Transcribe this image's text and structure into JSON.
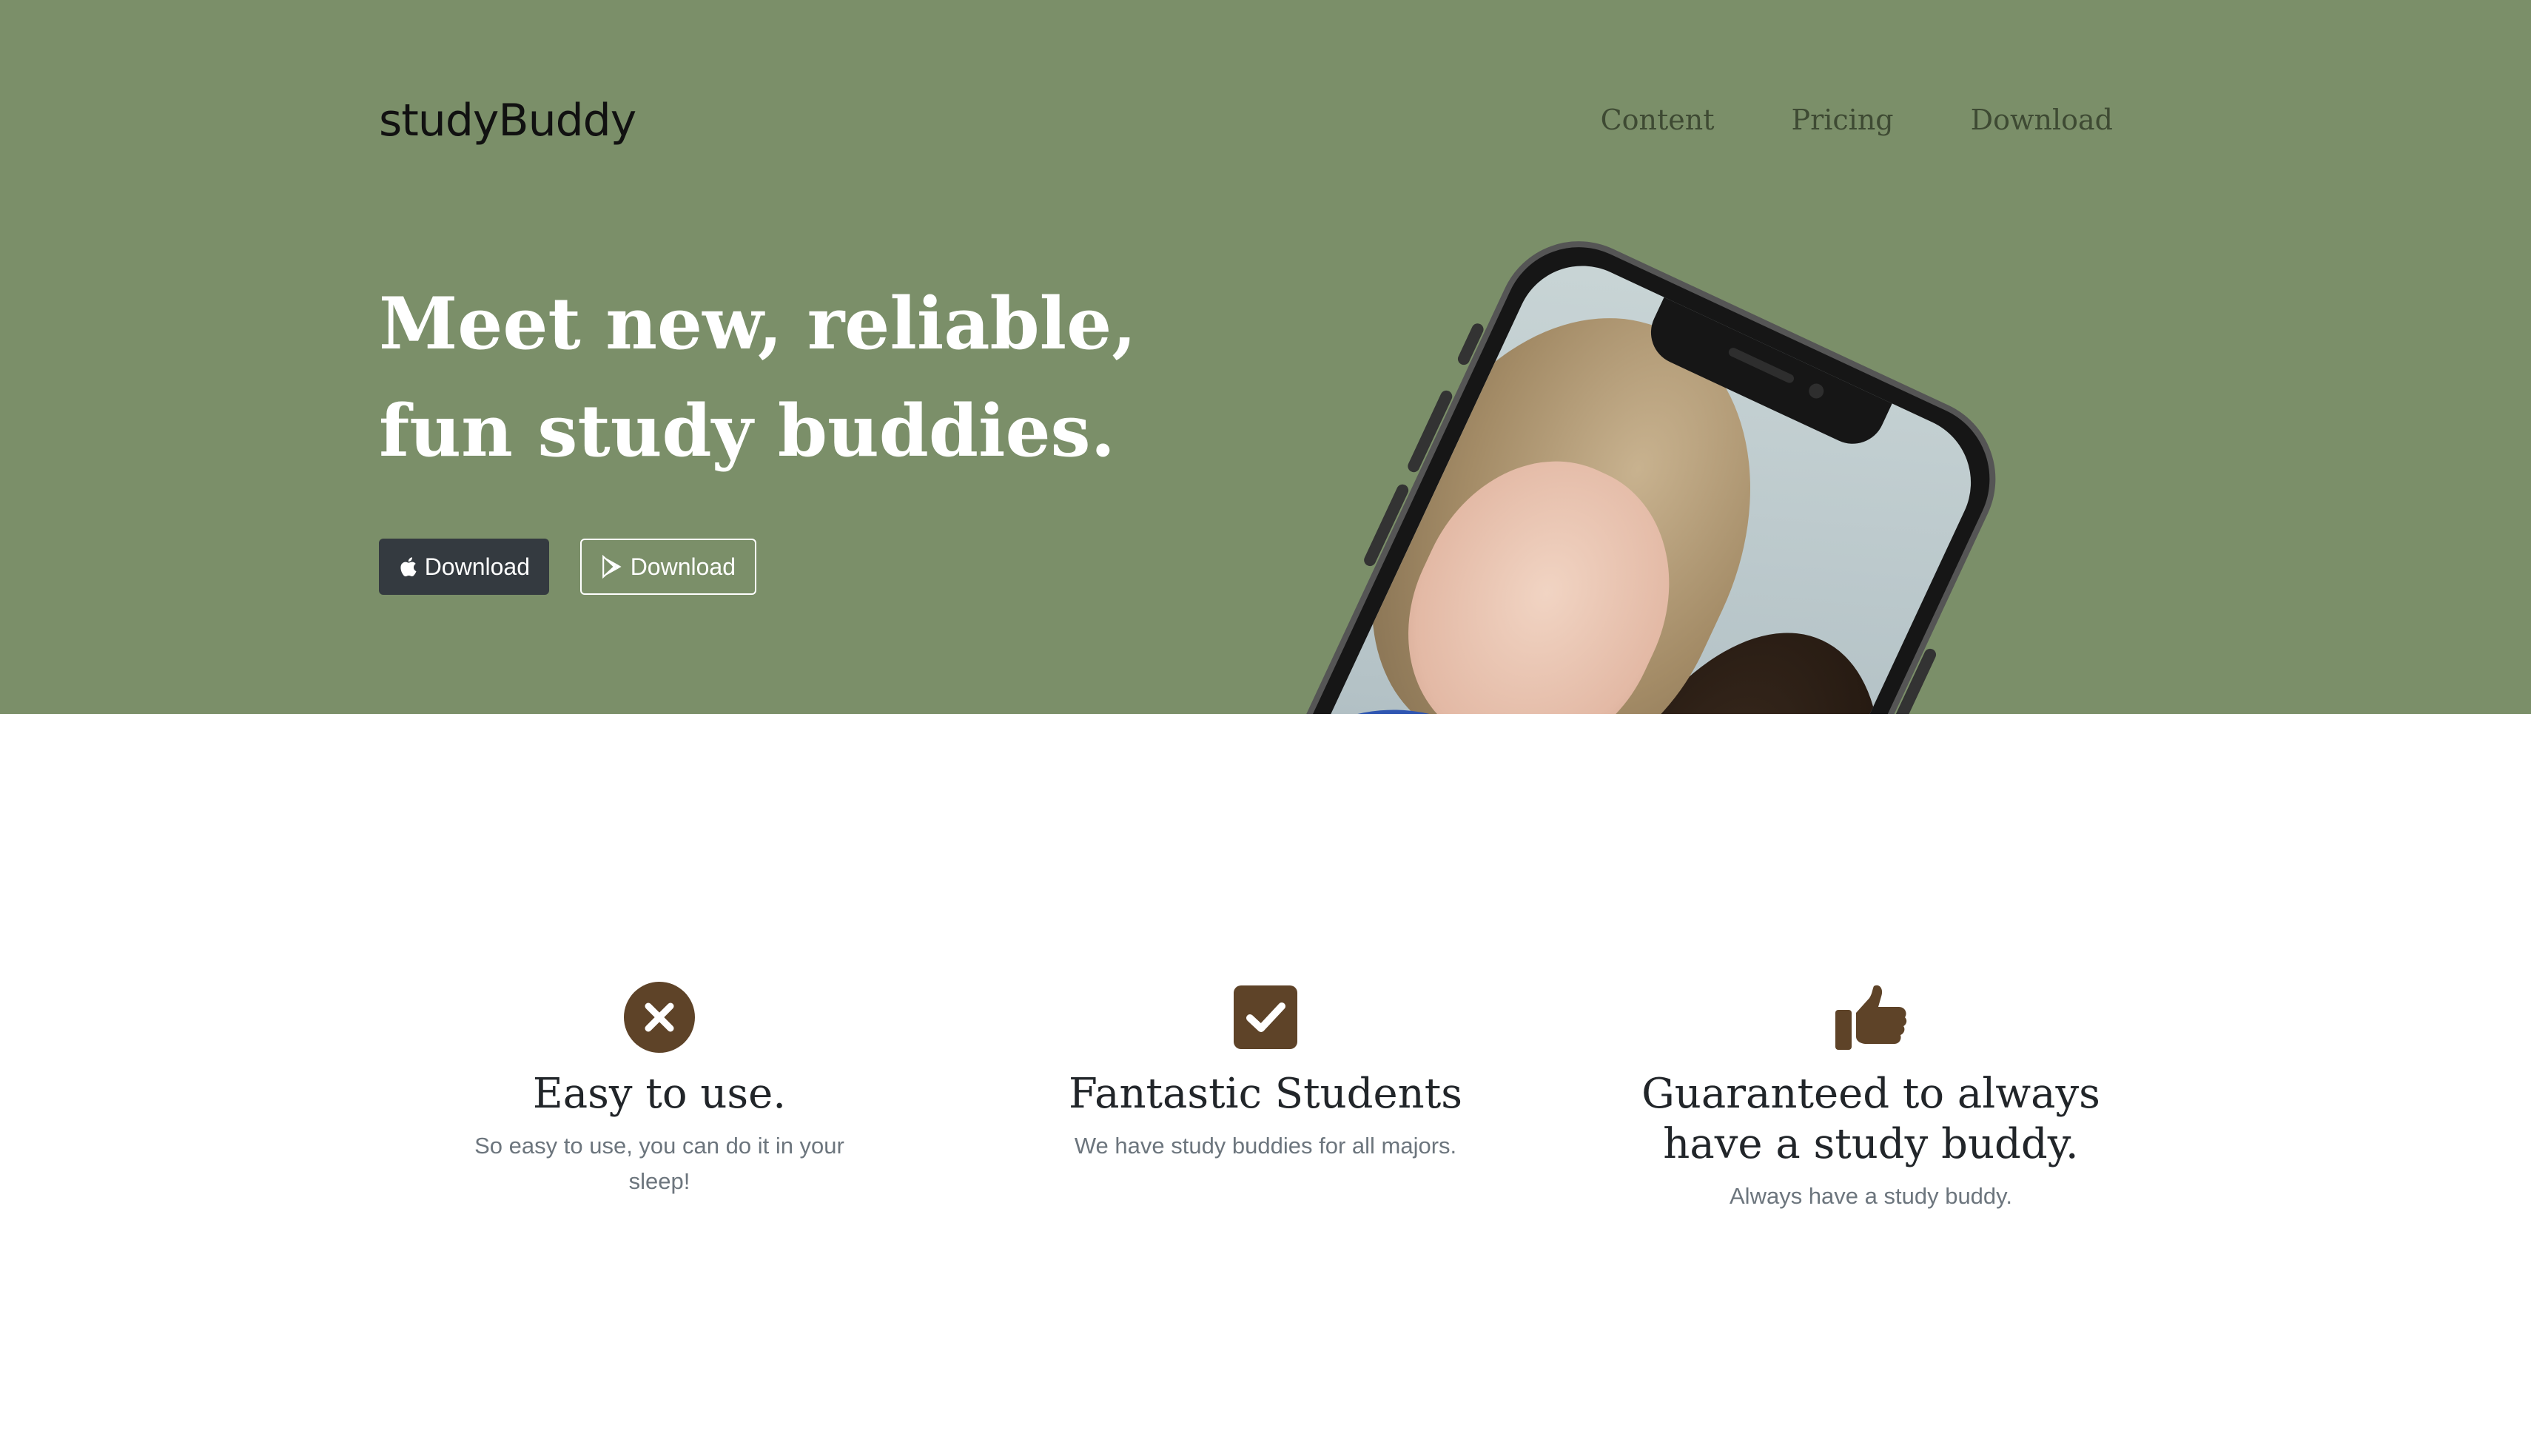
{
  "header": {
    "brand": "studyBuddy",
    "nav": [
      "Content",
      "Pricing",
      "Download"
    ]
  },
  "hero": {
    "headline": "Meet new, reliable, fun study buddies.",
    "buttons": {
      "apple": {
        "label": "Download",
        "icon": "apple-icon"
      },
      "play": {
        "label": "Download",
        "icon": "google-play-icon"
      }
    }
  },
  "features": [
    {
      "icon": "x-circle-icon",
      "title": "Easy to use.",
      "text": "So easy to use, you can do it in your sleep!"
    },
    {
      "icon": "checkbox-icon",
      "title": "Fantastic Students",
      "text": "We have study buddies for all majors."
    },
    {
      "icon": "thumbs-up-icon",
      "title": "Guaranteed to always have a study buddy.",
      "text": "Always have a study buddy."
    }
  ],
  "colors": {
    "hero_bg": "#7b8f69",
    "icon_brown": "#5e4328",
    "dark_button": "#343a40"
  }
}
